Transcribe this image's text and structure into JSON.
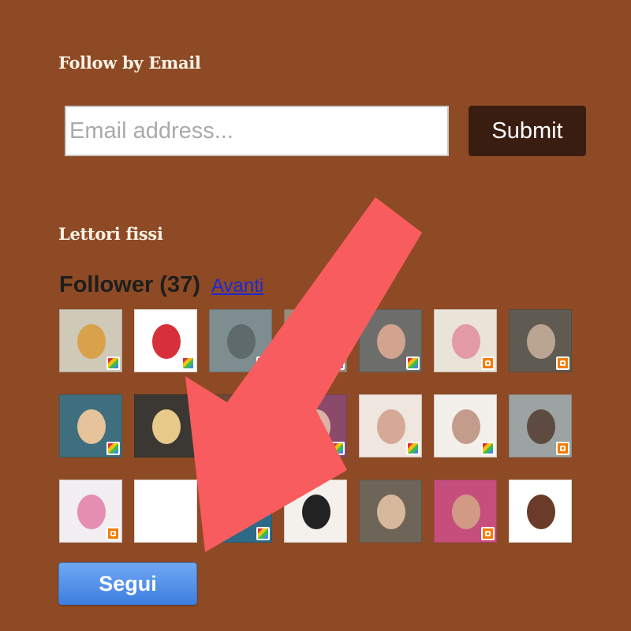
{
  "follow_email": {
    "title": "Follow by Email",
    "placeholder": "Email address...",
    "value": "",
    "submit_label": "Submit"
  },
  "followers_widget": {
    "title": "Lettori fissi",
    "heading_label": "Follower",
    "count_text": "(37)",
    "next_link": "Avanti",
    "follow_button": "Segui"
  },
  "avatars": [
    {
      "bg": "#cfc9b8",
      "face": "#d8a24a",
      "badge": "google"
    },
    {
      "bg": "#ffffff",
      "face": "#d7303a",
      "badge": "google"
    },
    {
      "bg": "#7d8d90",
      "face": "#5e6a6b",
      "badge": "google"
    },
    {
      "bg": "#9b8b7b",
      "face": "#d8c3a8",
      "badge": "google"
    },
    {
      "bg": "#6d6d6b",
      "face": "#d2a490",
      "badge": "google"
    },
    {
      "bg": "#e9e3d8",
      "face": "#e19aa6",
      "badge": "blogger"
    },
    {
      "bg": "#5f5a52",
      "face": "#b9a592",
      "badge": "blogger"
    },
    {
      "bg": "#3f6f7e",
      "face": "#e6c39a",
      "badge": "google"
    },
    {
      "bg": "#3b3833",
      "face": "#e7c98a",
      "badge": "none"
    },
    {
      "bg": "#6a4a36",
      "face": "#c99c83",
      "badge": "none"
    },
    {
      "bg": "#8b4a6b",
      "face": "#d8b3a6",
      "badge": "google"
    },
    {
      "bg": "#eee6df",
      "face": "#d6a896",
      "badge": "google"
    },
    {
      "bg": "#f3efea",
      "face": "#c49c8c",
      "badge": "google"
    },
    {
      "bg": "#9ca3a2",
      "face": "#5d4b41",
      "badge": "blogger"
    },
    {
      "bg": "#f2eef1",
      "face": "#e48fb2",
      "badge": "blogger"
    },
    {
      "bg": "#ffffff",
      "face": "#ffffff",
      "badge": "none"
    },
    {
      "bg": "#2e6a85",
      "face": "#c79b80",
      "badge": "google"
    },
    {
      "bg": "#f4f0ec",
      "face": "#222222",
      "badge": "none"
    },
    {
      "bg": "#6e6457",
      "face": "#d8b89d",
      "badge": "none"
    },
    {
      "bg": "#c64e7d",
      "face": "#d29a84",
      "badge": "blogger"
    },
    {
      "bg": "#ffffff",
      "face": "#6a3b28",
      "badge": "none"
    }
  ],
  "colors": {
    "page_bg": "#8e4a24",
    "title_text": "#fdf2e6",
    "submit_bg": "#3a1d11",
    "link": "#1b28d6",
    "segui_button": "#4a8aea",
    "annotation_arrow": "#f95c5e"
  }
}
